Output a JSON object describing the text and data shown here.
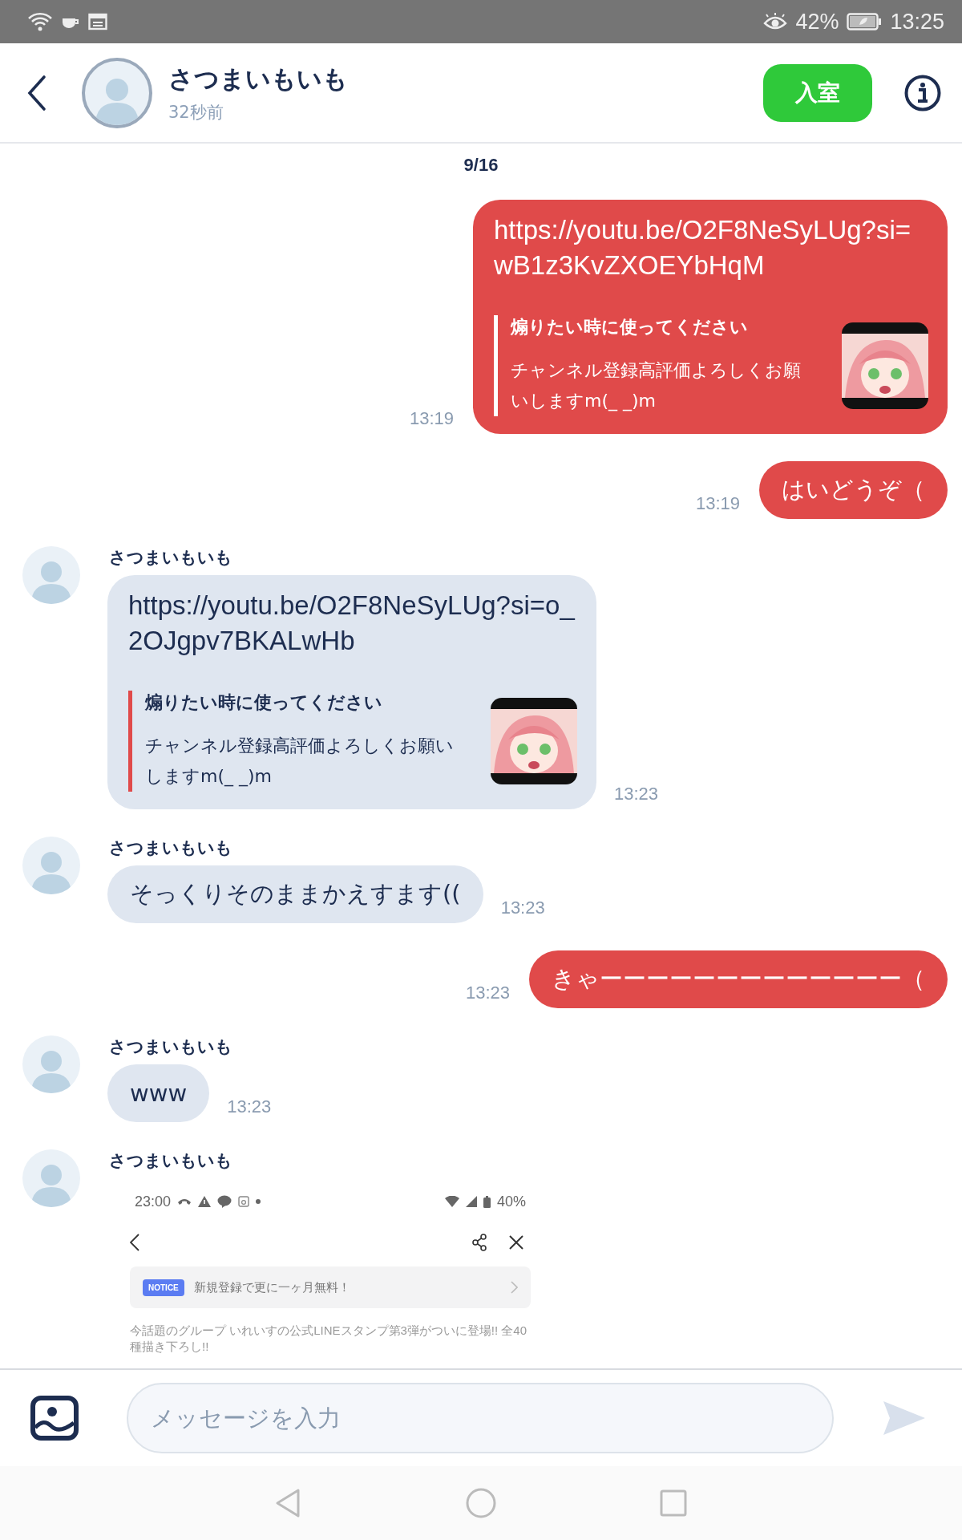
{
  "status_bar": {
    "battery": "42%",
    "time": "13:25"
  },
  "header": {
    "name": "さつまいもいも",
    "last_seen": "32秒前",
    "enter_button": "入室"
  },
  "date": "9/16",
  "messages": [
    {
      "kind": "link",
      "outgoing": true,
      "url": "https://youtu.be/O2F8NeSyLUg?si=wB1z3KvZXOEYbHqM",
      "preview_title": "煽りたい時に使ってください",
      "preview_text": "チャンネル登録高評価よろしくお願いしますm(_ _)m",
      "time": "13:19"
    },
    {
      "kind": "text",
      "outgoing": true,
      "text": "はいどうぞ（",
      "time": "13:19"
    },
    {
      "kind": "link",
      "outgoing": false,
      "sender": "さつまいもいも",
      "url": "https://youtu.be/O2F8NeSyLUg?si=o_2OJgpv7BKALwHb",
      "preview_title": "煽りたい時に使ってください",
      "preview_text": "チャンネル登録高評価よろしくお願いしますm(_ _)m",
      "time": "13:23"
    },
    {
      "kind": "text",
      "outgoing": false,
      "sender": "さつまいもいも",
      "text": "そっくりそのままかえすます((",
      "time": "13:23"
    },
    {
      "kind": "text",
      "outgoing": true,
      "text": "きゃーーーーーーーーーーーーー（",
      "time": "13:23"
    },
    {
      "kind": "text",
      "outgoing": false,
      "sender": "さつまいもいも",
      "text": "www",
      "time": "13:23"
    },
    {
      "kind": "screenshot",
      "outgoing": false,
      "sender": "さつまいもいも",
      "shot_time": "23:00",
      "shot_battery": "40%",
      "notice_badge": "NOTICE",
      "notice_text": "新規登録で更に一ヶ月無料！",
      "body": "今話題のグループ いれいすの公式LINEスタンプ第3弾がついに登場!! 全40種描き下ろし!!"
    }
  ],
  "input": {
    "placeholder": "メッセージを入力"
  }
}
